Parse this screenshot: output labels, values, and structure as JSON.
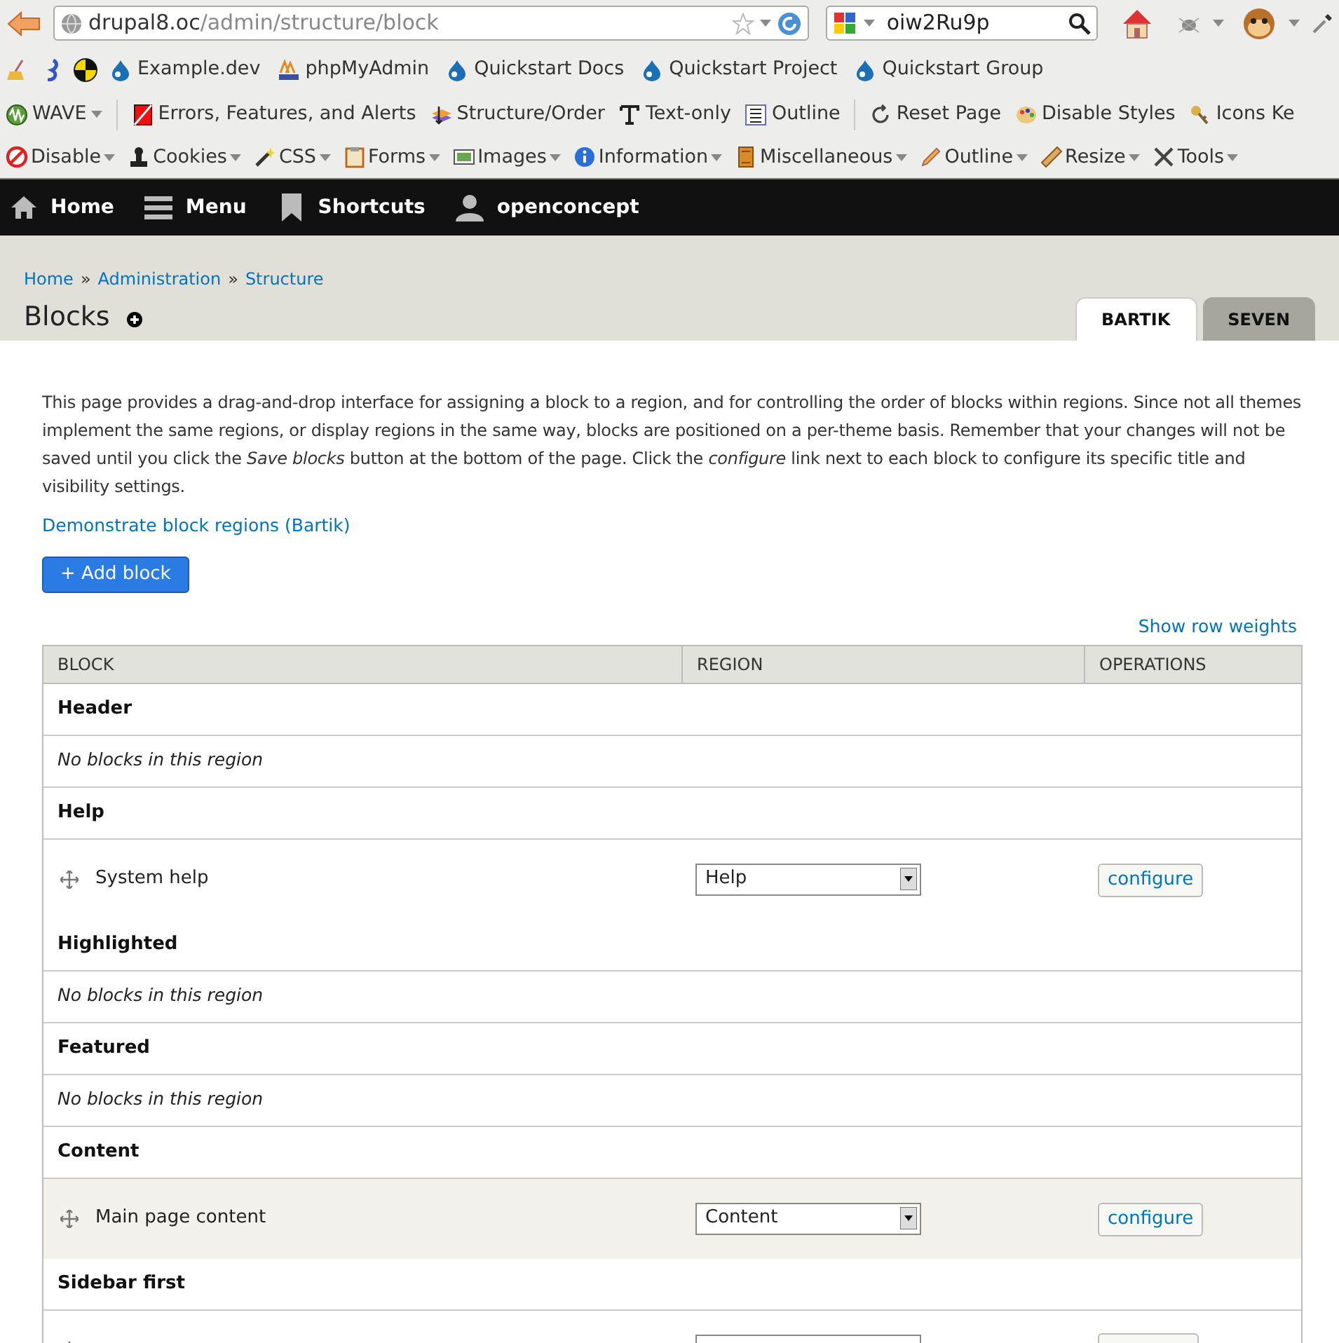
{
  "browser": {
    "url_host": "drupal8.oc",
    "url_path": "/admin/structure/block",
    "search_value": "oiw2Ru9p",
    "bookmarks": [
      "Example.dev",
      "phpMyAdmin",
      "Quickstart Docs",
      "Quickstart Project",
      "Quickstart Group"
    ],
    "wave_toolbar": [
      "WAVE",
      "Errors, Features, and Alerts",
      "Structure/Order",
      "Text-only",
      "Outline",
      "Reset Page",
      "Disable Styles",
      "Icons Ke"
    ],
    "developer_toolbar": [
      "Disable",
      "Cookies",
      "CSS",
      "Forms",
      "Images",
      "Information",
      "Miscellaneous",
      "Outline",
      "Resize",
      "Tools"
    ]
  },
  "admin_toolbar": [
    "Home",
    "Menu",
    "Shortcuts",
    "openconcept"
  ],
  "breadcrumb": [
    {
      "kind": "link",
      "text": "Home"
    },
    {
      "kind": "separator",
      "text": "»"
    },
    {
      "kind": "link",
      "text": "Administration"
    },
    {
      "kind": "separator",
      "text": "»"
    },
    {
      "kind": "link",
      "text": "Structure"
    }
  ],
  "page_title": "Blocks",
  "theme_tabs": [
    {
      "label": "BARTIK",
      "selected": true
    },
    {
      "label": "SEVEN",
      "selected": false
    }
  ],
  "description": "This page provides a drag-and-drop interface for assigning a block to a region, and for controlling the order of blocks within regions. Since not all themes implement the same regions, or display regions in the same way, blocks are positioned on a per-theme basis. Remember that your changes will not be saved until you click the *Save blocks* button at the bottom of the page. Click the *configure* link next to each block to configure its specific title and visibility settings.",
  "demo_link": "Demonstrate block regions (Bartik)",
  "add_button": "+ Add block",
  "row_weights_link": "Show row weights",
  "table": {
    "columns": [
      "BLOCK",
      "REGION",
      "OPERATIONS"
    ],
    "rows": [
      {
        "kind": "region",
        "title": "Header"
      },
      {
        "kind": "empty",
        "text": "No blocks in this region"
      },
      {
        "kind": "region",
        "title": "Help"
      },
      {
        "kind": "block",
        "name": "System help",
        "region": "Help",
        "operation": "configure",
        "highlighted": false
      },
      {
        "kind": "region",
        "title": "Highlighted"
      },
      {
        "kind": "empty",
        "text": "No blocks in this region"
      },
      {
        "kind": "region",
        "title": "Featured"
      },
      {
        "kind": "empty",
        "text": "No blocks in this region"
      },
      {
        "kind": "region",
        "title": "Content"
      },
      {
        "kind": "block",
        "name": "Main page content",
        "region": "Content",
        "operation": "configure",
        "highlighted": true
      },
      {
        "kind": "region",
        "title": "Sidebar first"
      },
      {
        "kind": "cutoff"
      }
    ]
  }
}
